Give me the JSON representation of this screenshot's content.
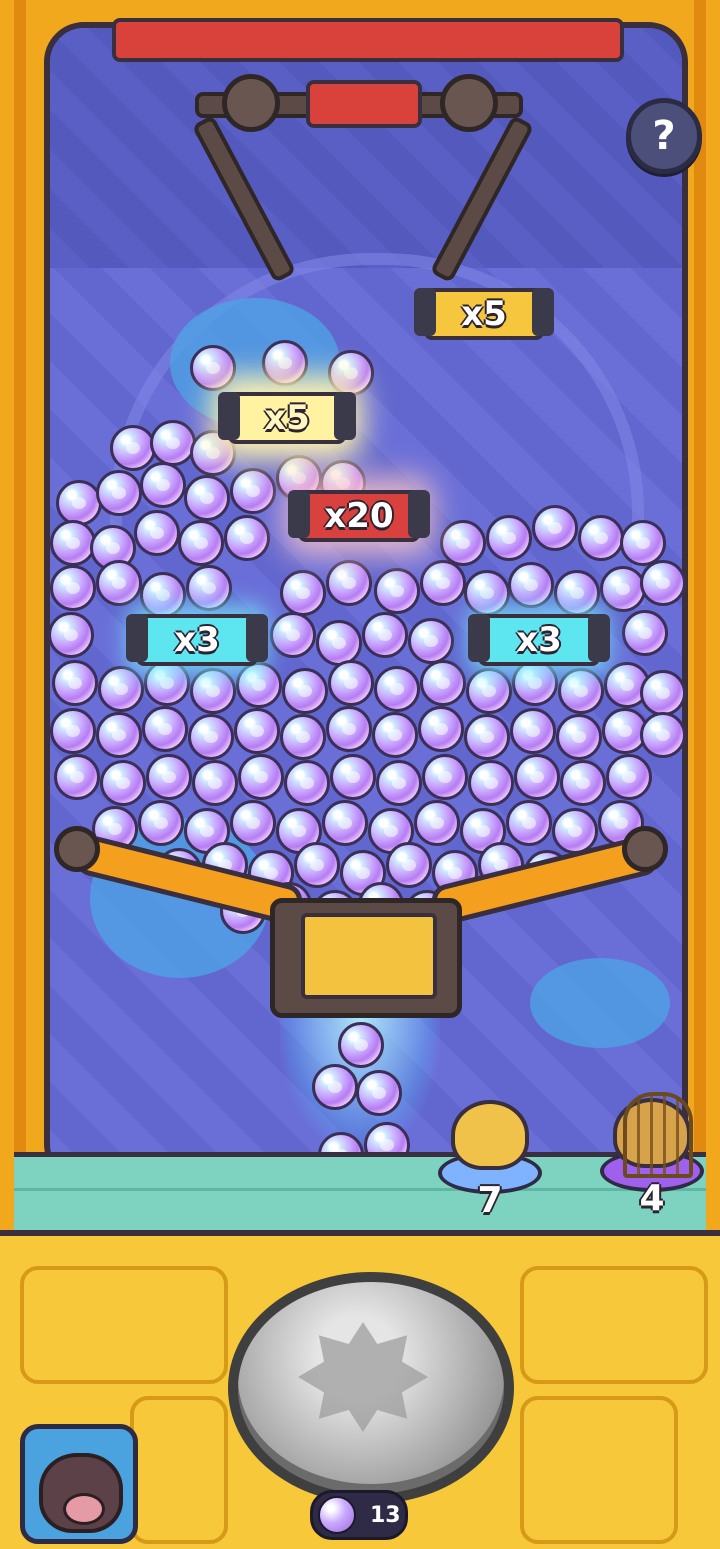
{
  "help_button": {
    "label": "?"
  },
  "multipliers": [
    {
      "label": "x5"
    },
    {
      "label": "x5"
    },
    {
      "label": "x20"
    },
    {
      "label": "x3"
    },
    {
      "label": "x3"
    }
  ],
  "pets": [
    {
      "count": "7",
      "dish_color": "#7fb2ff"
    },
    {
      "count": "4",
      "dish_color": "#a060ee"
    }
  ],
  "ball_counter": {
    "value": "13",
    "icon": "paw-ball-icon"
  },
  "colors": {
    "frame": "#f2a81d",
    "glass": "#6a6fd8",
    "floor": "#7dd2c0",
    "ball": "#c9a9ff"
  }
}
